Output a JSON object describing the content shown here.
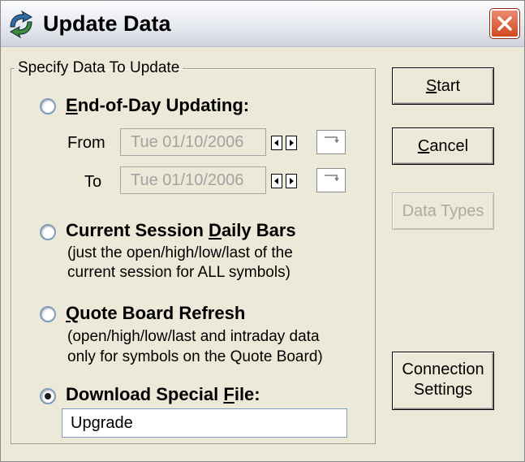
{
  "window": {
    "title": "Update Data"
  },
  "group": {
    "label": "Specify Data To Update"
  },
  "options": {
    "eod": {
      "label_pre": "",
      "label_ul": "E",
      "label_post": "nd-of-Day Updating:",
      "selected": false
    },
    "daily": {
      "label_pre": "Current Session ",
      "label_ul": "D",
      "label_post": "aily Bars",
      "desc1": "(just the open/high/low/last of the",
      "desc2": "current session for ALL symbols)",
      "selected": false
    },
    "quote": {
      "label_pre": "",
      "label_ul": "Q",
      "label_post": "uote Board Refresh",
      "desc1": "(open/high/low/last and intraday data",
      "desc2": "only for symbols on the Quote Board)",
      "selected": false
    },
    "special": {
      "label_pre": "Download Special ",
      "label_ul": "F",
      "label_post": "ile:",
      "selected": true
    }
  },
  "dates": {
    "from_label": "From",
    "from_value": "Tue  01/10/2006",
    "to_label": "To",
    "to_value": "Tue  01/10/2006"
  },
  "special_file": {
    "value": "Upgrade"
  },
  "buttons": {
    "start_ul": "S",
    "start_rest": "tart",
    "cancel_ul": "C",
    "cancel_rest": "ancel",
    "data_types": "Data Types",
    "connection_1": "Connection",
    "connection_2": "Settings"
  }
}
